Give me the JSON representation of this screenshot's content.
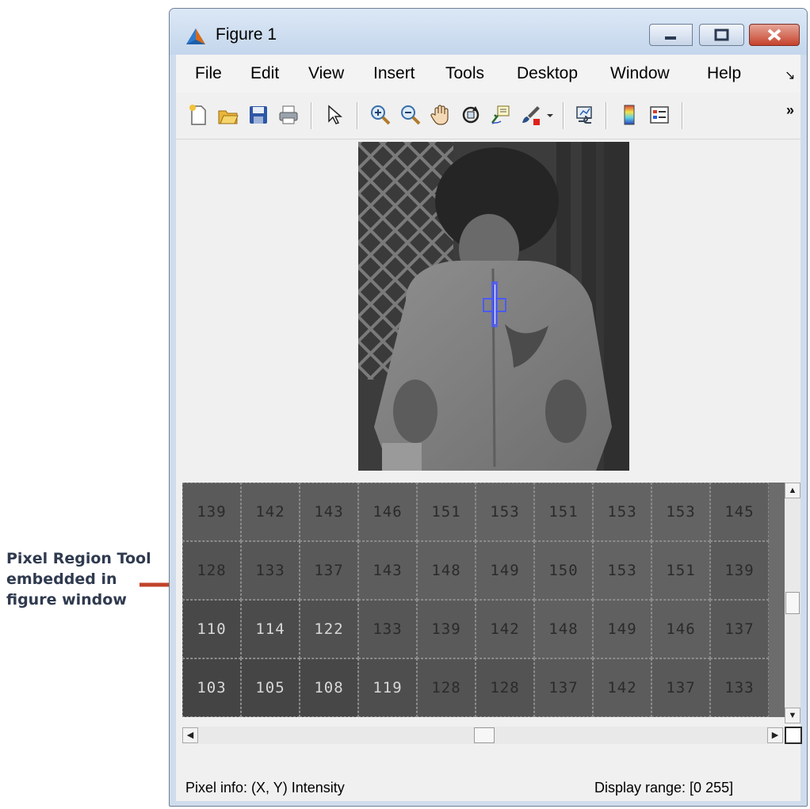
{
  "annotation": {
    "lines": [
      "Pixel Region Tool",
      "embedded in",
      "figure window"
    ]
  },
  "window": {
    "title": "Figure 1",
    "controls": {
      "minimize": "minimize",
      "maximize": "maximize",
      "close": "close"
    }
  },
  "menu": {
    "items": [
      "File",
      "Edit",
      "View",
      "Insert",
      "Tools",
      "Desktop",
      "Window",
      "Help"
    ],
    "overflow_glyph": "↘"
  },
  "toolbar": {
    "buttons": [
      {
        "name": "new-figure-icon"
      },
      {
        "name": "open-file-icon"
      },
      {
        "name": "save-figure-icon"
      },
      {
        "name": "print-figure-icon"
      },
      {
        "name": "edit-plot-icon"
      },
      {
        "name": "zoom-in-icon"
      },
      {
        "name": "zoom-out-icon"
      },
      {
        "name": "pan-icon"
      },
      {
        "name": "rotate-3d-icon"
      },
      {
        "name": "data-cursor-icon"
      },
      {
        "name": "brush-icon"
      },
      {
        "name": "link-plot-icon"
      },
      {
        "name": "insert-colorbar-icon"
      },
      {
        "name": "insert-legend-icon"
      }
    ],
    "overflow_glyph": "»"
  },
  "pixel_region": {
    "rows": [
      [
        139,
        142,
        143,
        146,
        151,
        153,
        151,
        153,
        153,
        145
      ],
      [
        128,
        133,
        137,
        143,
        148,
        149,
        150,
        153,
        151,
        139
      ],
      [
        110,
        114,
        122,
        133,
        139,
        142,
        148,
        149,
        146,
        137
      ],
      [
        103,
        105,
        108,
        119,
        128,
        128,
        137,
        142,
        137,
        133
      ]
    ],
    "scroll": {
      "vertical_position": 0.5,
      "horizontal_position": 0.5
    }
  },
  "status": {
    "pixel_info": "Pixel info: (X, Y)  Intensity",
    "display_range": "Display range: [0 255]"
  }
}
